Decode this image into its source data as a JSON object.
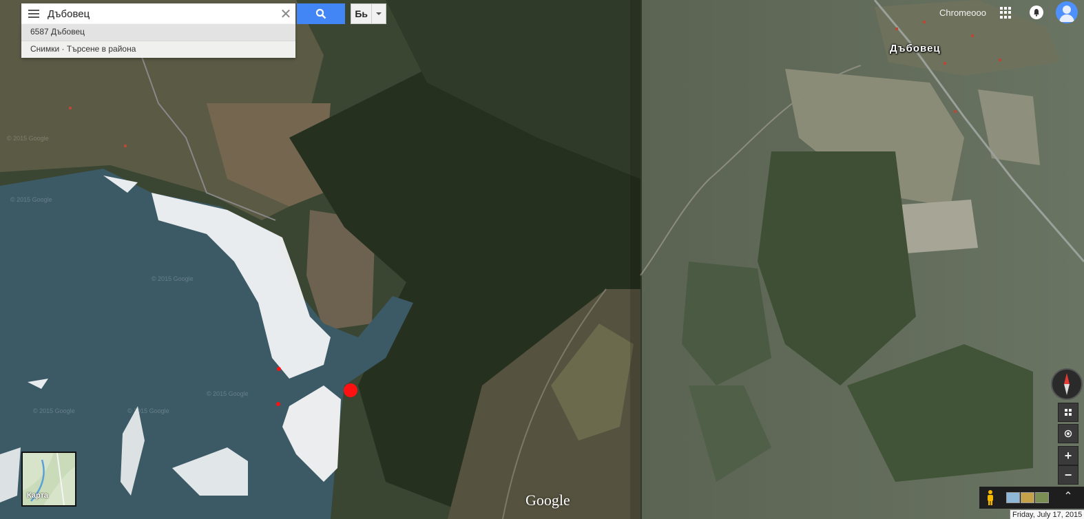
{
  "search": {
    "query": "Дъбовец",
    "suggestions": [
      "6587 Дъбовец",
      "Снимки · Търсене в района"
    ],
    "language_label": "Бь"
  },
  "account": {
    "name": "Chromeooo"
  },
  "map": {
    "place_label": "Дъбовец",
    "logo": "Google",
    "minimap_label": "Карта",
    "watermark": "© 2015 Google",
    "date_tooltip": "Friday, July 17, 2015"
  },
  "colors": {
    "search_button": "#4285f4",
    "marker": "#ff1111",
    "water": "#3b5a66",
    "forest": "#2c3a26"
  },
  "icons": {
    "menu": "hamburger-icon",
    "clear": "close-icon",
    "search": "search-icon",
    "apps": "apps-grid-icon",
    "notifications": "bell-icon",
    "avatar": "user-avatar-icon",
    "compass": "compass-icon",
    "street_view": "pegman-icon"
  }
}
